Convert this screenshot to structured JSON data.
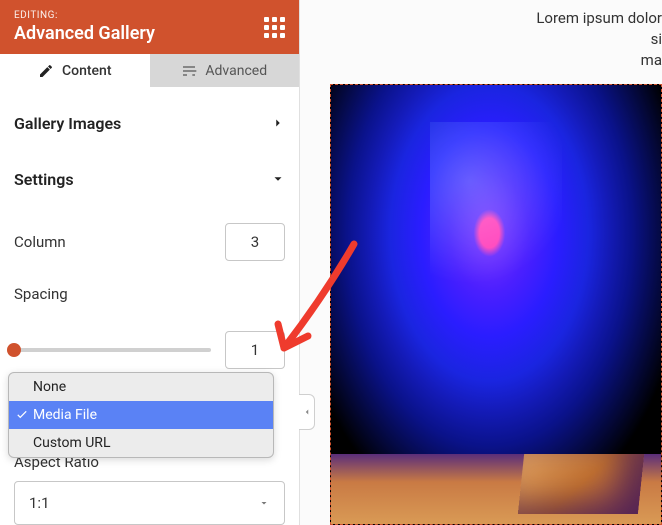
{
  "header": {
    "editing_label": "EDITING:",
    "title": "Advanced Gallery"
  },
  "tabs": {
    "content": "Content",
    "advanced": "Advanced"
  },
  "sections": {
    "gallery_images": "Gallery Images",
    "settings": "Settings"
  },
  "fields": {
    "column_label": "Column",
    "column_value": "3",
    "spacing_label": "Spacing",
    "spacing_value": "1",
    "aspect_partial": "Aspect Ratio",
    "aspect_value": "1:1"
  },
  "dropdown": {
    "items": [
      "None",
      "Media File",
      "Custom URL"
    ],
    "selected_index": 1
  },
  "preview": {
    "lorem_line1": "Lorem ipsum dolor si",
    "lorem_line2": "ma"
  }
}
